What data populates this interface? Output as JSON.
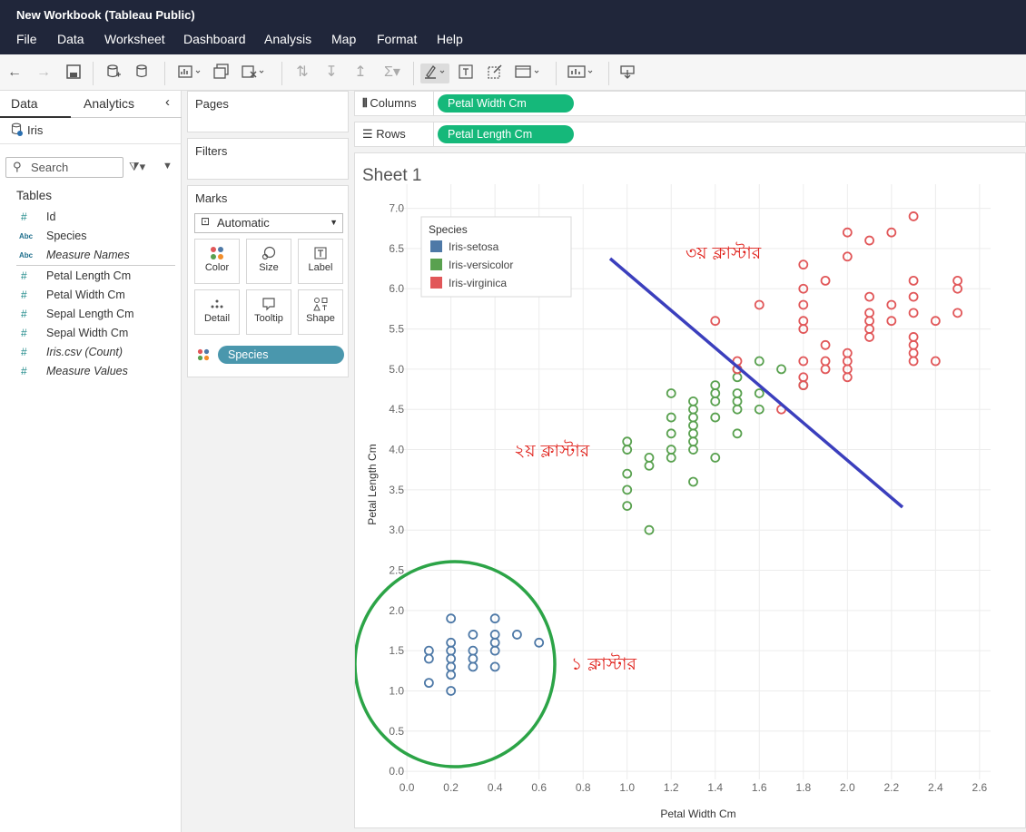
{
  "window": {
    "title": "New Workbook (Tableau Public)"
  },
  "menu": [
    "File",
    "Data",
    "Worksheet",
    "Dashboard",
    "Analysis",
    "Map",
    "Format",
    "Help"
  ],
  "left_pane": {
    "tabs": [
      "Data",
      "Analytics"
    ],
    "datasource": "Iris",
    "search_placeholder": "Search",
    "tables_header": "Tables",
    "fields": [
      {
        "label": "Id",
        "type": "measure",
        "italic": false
      },
      {
        "label": "Species",
        "type": "dimension",
        "italic": false
      },
      {
        "label": "Measure Names",
        "type": "dimension",
        "italic": true
      },
      {
        "label": "Petal Length Cm",
        "type": "measure",
        "italic": false
      },
      {
        "label": "Petal Width Cm",
        "type": "measure",
        "italic": false
      },
      {
        "label": "Sepal Length Cm",
        "type": "measure",
        "italic": false
      },
      {
        "label": "Sepal Width Cm",
        "type": "measure",
        "italic": false
      },
      {
        "label": "Iris.csv (Count)",
        "type": "measure",
        "italic": true
      },
      {
        "label": "Measure Values",
        "type": "measure",
        "italic": true
      }
    ]
  },
  "cards": {
    "pages": "Pages",
    "filters": "Filters",
    "marks": "Marks",
    "marks_type": "Automatic",
    "mark_buttons": [
      "Color",
      "Size",
      "Label",
      "Detail",
      "Tooltip",
      "Shape"
    ],
    "color_pill": "Species"
  },
  "shelves": {
    "columns_label": "Columns",
    "columns_pill": "Petal Width Cm",
    "rows_label": "Rows",
    "rows_pill": "Petal Length Cm"
  },
  "sheet": {
    "title": "Sheet 1",
    "annotations": {
      "cluster1": "১ ক্লাস্টার",
      "cluster2": "২য় ক্লাস্টার",
      "cluster3": "৩য় ক্লাস্টার"
    }
  },
  "colors": {
    "setosa": "#4e79a7",
    "versicolor": "#59a14f",
    "virginica": "#e15759",
    "annotation_text": "#e0201a",
    "divider_line": "#3b3fbd",
    "cluster_circle": "#2ca447",
    "pill_green": "#15b87a",
    "dark_bar": "#20263a"
  },
  "chart_data": {
    "type": "scatter",
    "xlabel": "Petal Width Cm",
    "ylabel": "Petal Length Cm",
    "xlim": [
      -0.05,
      2.65
    ],
    "ylim": [
      -0.1,
      7.3
    ],
    "xticks": [
      "0.0",
      "0.2",
      "0.4",
      "0.6",
      "0.8",
      "1.0",
      "1.2",
      "1.4",
      "1.6",
      "1.8",
      "2.0",
      "2.2",
      "2.4",
      "2.6"
    ],
    "yticks": [
      "0.0",
      "0.5",
      "1.0",
      "1.5",
      "2.0",
      "2.5",
      "3.0",
      "3.5",
      "4.0",
      "4.5",
      "5.0",
      "5.5",
      "6.0",
      "6.5",
      "7.0"
    ],
    "grid": true,
    "legend": {
      "title": "Species",
      "placement": "top-left"
    },
    "series": [
      {
        "name": "Iris-setosa",
        "color": "#4e79a7",
        "points": [
          [
            0.1,
            1.1
          ],
          [
            0.1,
            1.4
          ],
          [
            0.1,
            1.5
          ],
          [
            0.2,
            1.0
          ],
          [
            0.2,
            1.2
          ],
          [
            0.2,
            1.3
          ],
          [
            0.2,
            1.4
          ],
          [
            0.2,
            1.5
          ],
          [
            0.2,
            1.6
          ],
          [
            0.2,
            1.9
          ],
          [
            0.3,
            1.3
          ],
          [
            0.3,
            1.4
          ],
          [
            0.3,
            1.5
          ],
          [
            0.3,
            1.7
          ],
          [
            0.4,
            1.3
          ],
          [
            0.4,
            1.5
          ],
          [
            0.4,
            1.6
          ],
          [
            0.4,
            1.7
          ],
          [
            0.4,
            1.9
          ],
          [
            0.5,
            1.7
          ],
          [
            0.6,
            1.6
          ]
        ]
      },
      {
        "name": "Iris-versicolor",
        "color": "#59a14f",
        "points": [
          [
            1.0,
            3.3
          ],
          [
            1.0,
            3.5
          ],
          [
            1.0,
            3.7
          ],
          [
            1.0,
            4.0
          ],
          [
            1.0,
            4.1
          ],
          [
            1.1,
            3.0
          ],
          [
            1.1,
            3.8
          ],
          [
            1.1,
            3.9
          ],
          [
            1.2,
            3.9
          ],
          [
            1.2,
            4.0
          ],
          [
            1.2,
            4.2
          ],
          [
            1.2,
            4.4
          ],
          [
            1.2,
            4.7
          ],
          [
            1.3,
            3.6
          ],
          [
            1.3,
            4.0
          ],
          [
            1.3,
            4.1
          ],
          [
            1.3,
            4.2
          ],
          [
            1.3,
            4.3
          ],
          [
            1.3,
            4.4
          ],
          [
            1.3,
            4.5
          ],
          [
            1.3,
            4.6
          ],
          [
            1.4,
            3.9
          ],
          [
            1.4,
            4.4
          ],
          [
            1.4,
            4.6
          ],
          [
            1.4,
            4.7
          ],
          [
            1.4,
            4.8
          ],
          [
            1.5,
            4.2
          ],
          [
            1.5,
            4.5
          ],
          [
            1.5,
            4.6
          ],
          [
            1.5,
            4.7
          ],
          [
            1.5,
            4.9
          ],
          [
            1.5,
            5.0
          ],
          [
            1.6,
            4.5
          ],
          [
            1.6,
            4.7
          ],
          [
            1.6,
            5.1
          ],
          [
            1.7,
            5.0
          ],
          [
            1.8,
            4.8
          ]
        ]
      },
      {
        "name": "Iris-virginica",
        "color": "#e15759",
        "points": [
          [
            1.4,
            5.6
          ],
          [
            1.5,
            5.0
          ],
          [
            1.5,
            5.1
          ],
          [
            1.6,
            5.8
          ],
          [
            1.7,
            4.5
          ],
          [
            1.8,
            4.8
          ],
          [
            1.8,
            4.9
          ],
          [
            1.8,
            5.1
          ],
          [
            1.8,
            5.5
          ],
          [
            1.8,
            5.6
          ],
          [
            1.8,
            5.8
          ],
          [
            1.8,
            6.0
          ],
          [
            1.8,
            6.3
          ],
          [
            1.9,
            5.0
          ],
          [
            1.9,
            5.1
          ],
          [
            1.9,
            5.3
          ],
          [
            1.9,
            6.1
          ],
          [
            2.0,
            4.9
          ],
          [
            2.0,
            5.0
          ],
          [
            2.0,
            5.1
          ],
          [
            2.0,
            5.2
          ],
          [
            2.0,
            6.4
          ],
          [
            2.0,
            6.7
          ],
          [
            2.1,
            5.4
          ],
          [
            2.1,
            5.5
          ],
          [
            2.1,
            5.6
          ],
          [
            2.1,
            5.7
          ],
          [
            2.1,
            5.9
          ],
          [
            2.1,
            6.6
          ],
          [
            2.2,
            5.6
          ],
          [
            2.2,
            5.8
          ],
          [
            2.2,
            6.7
          ],
          [
            2.3,
            5.1
          ],
          [
            2.3,
            5.2
          ],
          [
            2.3,
            5.3
          ],
          [
            2.3,
            5.4
          ],
          [
            2.3,
            5.7
          ],
          [
            2.3,
            5.9
          ],
          [
            2.3,
            6.1
          ],
          [
            2.3,
            6.9
          ],
          [
            2.4,
            5.1
          ],
          [
            2.4,
            5.6
          ],
          [
            2.5,
            5.7
          ],
          [
            2.5,
            6.0
          ],
          [
            2.5,
            6.1
          ]
        ]
      }
    ]
  }
}
